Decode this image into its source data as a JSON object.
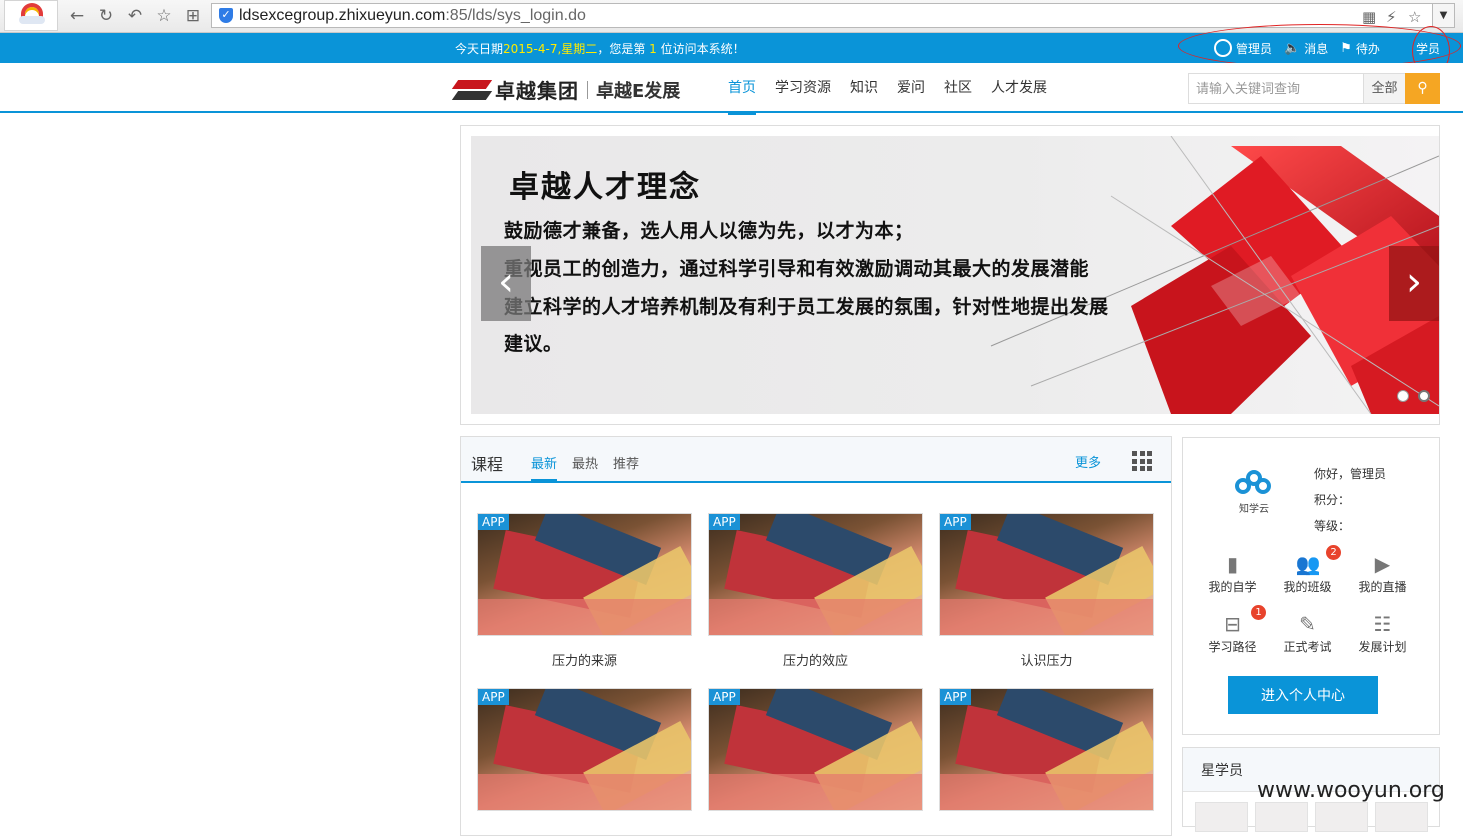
{
  "browser": {
    "url_host": "ldsexcegroup.zhixueyun.com",
    "url_path": ":85/lds/sys_login.do"
  },
  "topbar": {
    "welcome_prefix": "今天日期",
    "date": "2015-4-7,星期二",
    "welcome_mid": "，您是第 ",
    "visitor_count": "1",
    "welcome_suffix": " 位访问本系统！",
    "links": [
      {
        "label": "管理员",
        "icon": "user-circle-icon"
      },
      {
        "label": "消息",
        "icon": "speaker-icon"
      },
      {
        "label": "待办",
        "icon": "flag-icon"
      }
    ],
    "student_label": "学员"
  },
  "header": {
    "brand_name": "卓越集团",
    "brand_sub": "卓越E发展",
    "nav": [
      "首页",
      "学习资源",
      "知识",
      "爱问",
      "社区",
      "人才发展"
    ],
    "active_nav": 0,
    "search_placeholder": "请输入关键词查询",
    "search_scope": "全部",
    "colors": {
      "accent": "#0a94d8",
      "search_button": "#f5a623"
    }
  },
  "banner": {
    "title": "卓越人才理念",
    "lines": [
      "鼓励德才兼备，选人用人以德为先，以才为本；",
      "重视员工的创造力，通过科学引导和有效激励调动其最大的发展潜能",
      "建立科学的人才培养机制及有利于员工发展的氛围，针对性地提出发展",
      "建议。"
    ],
    "prev": "‹",
    "next": "›",
    "slide_count": 2,
    "active_slide": 1
  },
  "courses": {
    "title": "课程",
    "tabs": [
      "最新",
      "最热",
      "推荐"
    ],
    "active_tab": 0,
    "more": "更多",
    "badge": "APP",
    "items": [
      {
        "name": "压力的来源"
      },
      {
        "name": "压力的效应"
      },
      {
        "name": "认识压力"
      },
      {
        "name": ""
      },
      {
        "name": ""
      },
      {
        "name": ""
      }
    ]
  },
  "user": {
    "logo_caption": "知学云",
    "greeting": "你好，管理员",
    "points_label": "积分：",
    "level_label": "等级：",
    "tiles": [
      {
        "label": "我的自学",
        "icon": "book-icon",
        "count": ""
      },
      {
        "label": "我的班级",
        "icon": "group-icon",
        "count": "2"
      },
      {
        "label": "我的直播",
        "icon": "play-icon",
        "count": ""
      },
      {
        "label": "学习路径",
        "icon": "path-icon",
        "count": "1"
      },
      {
        "label": "正式考试",
        "icon": "pencil-icon",
        "count": ""
      },
      {
        "label": "发展计划",
        "icon": "calendar-icon",
        "count": ""
      }
    ],
    "enter_button": "进入个人中心"
  },
  "stars": {
    "title": "星学员"
  },
  "watermark": "www.wooyun.org"
}
